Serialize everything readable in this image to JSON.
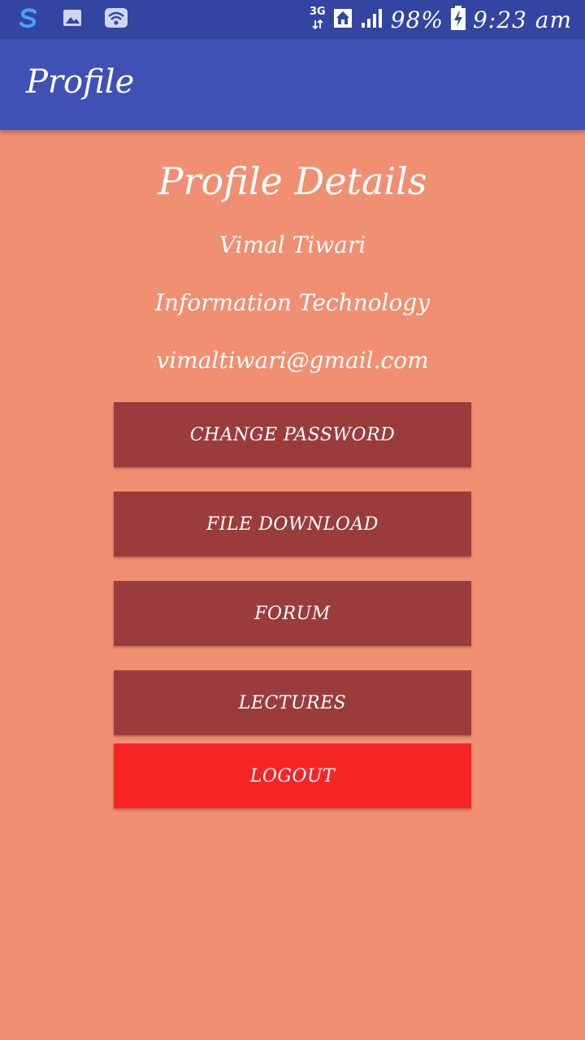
{
  "status_bar": {
    "network": "3G",
    "battery": "98%",
    "time": "9:23 am",
    "icons": [
      "sync-s-icon",
      "image-icon",
      "wifi-icon",
      "data-arrows-icon",
      "home-icon",
      "signal-icon",
      "battery-charging-icon"
    ]
  },
  "app_bar": {
    "title": "Profile"
  },
  "profile": {
    "heading": "Profile Details",
    "name": "Vimal Tiwari",
    "department": "Information Technology",
    "email": "vimaltiwari@gmail.com"
  },
  "buttons": {
    "change_password": "CHANGE PASSWORD",
    "file_download": "FILE DOWNLOAD",
    "forum": "FORUM",
    "lectures": "LECTURES",
    "logout": "LOGOUT"
  },
  "colors": {
    "status_bar": "#3445a1",
    "app_bar": "#3f51b5",
    "background": "#f08f72",
    "button": "#9b3c3c",
    "logout_button": "#f62525"
  }
}
